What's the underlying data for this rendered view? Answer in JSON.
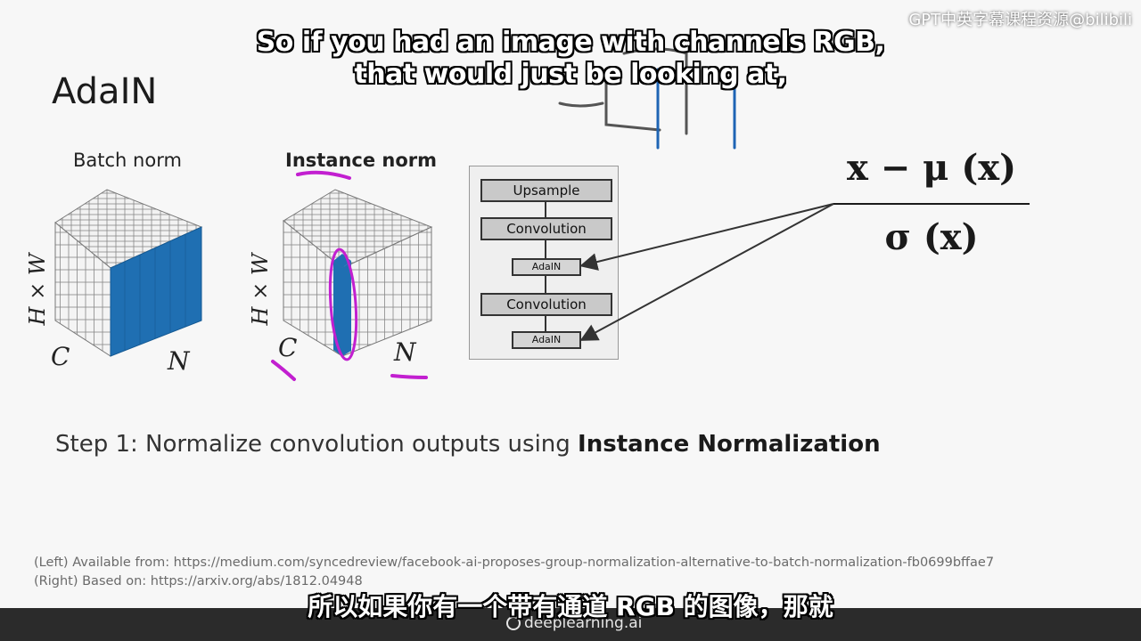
{
  "slide": {
    "title": "AdaIN",
    "batch_label": "Batch norm",
    "instance_label": "Instance norm",
    "axis_hw": "H × W",
    "axis_c": "C",
    "axis_n": "N",
    "arch": {
      "upsample": "Upsample",
      "conv1": "Convolution",
      "adain1": "AdaIN",
      "conv2": "Convolution",
      "adain2": "AdaIN"
    },
    "formula": {
      "numerator": "x − μ (x)",
      "denominator": "σ (x)"
    },
    "step_prefix": "Step 1: ",
    "step_text": "Normalize convolution outputs using ",
    "step_bold": "Instance Normalization",
    "ref_left": "(Left) Available from: https://medium.com/syncedreview/facebook-ai-proposes-group-normalization-alternative-to-batch-normalization-fb0699bffae7",
    "ref_right": "(Right) Based on: https://arxiv.org/abs/1812.04948"
  },
  "subtitles": {
    "en_line1": "So if you had an image with channels RGB,",
    "en_line2": "that would just be looking at,",
    "zh": "所以如果你有一个带有通道 RGB 的图像，那就"
  },
  "watermark": "GPT中英字幕课程资源@bilibili",
  "footer": {
    "brand": "deeplearning.ai"
  },
  "colors": {
    "cube_blue": "#1f6fb2",
    "annotation_magenta": "#c21fd0",
    "sketch_blue": "#1e64b4"
  }
}
